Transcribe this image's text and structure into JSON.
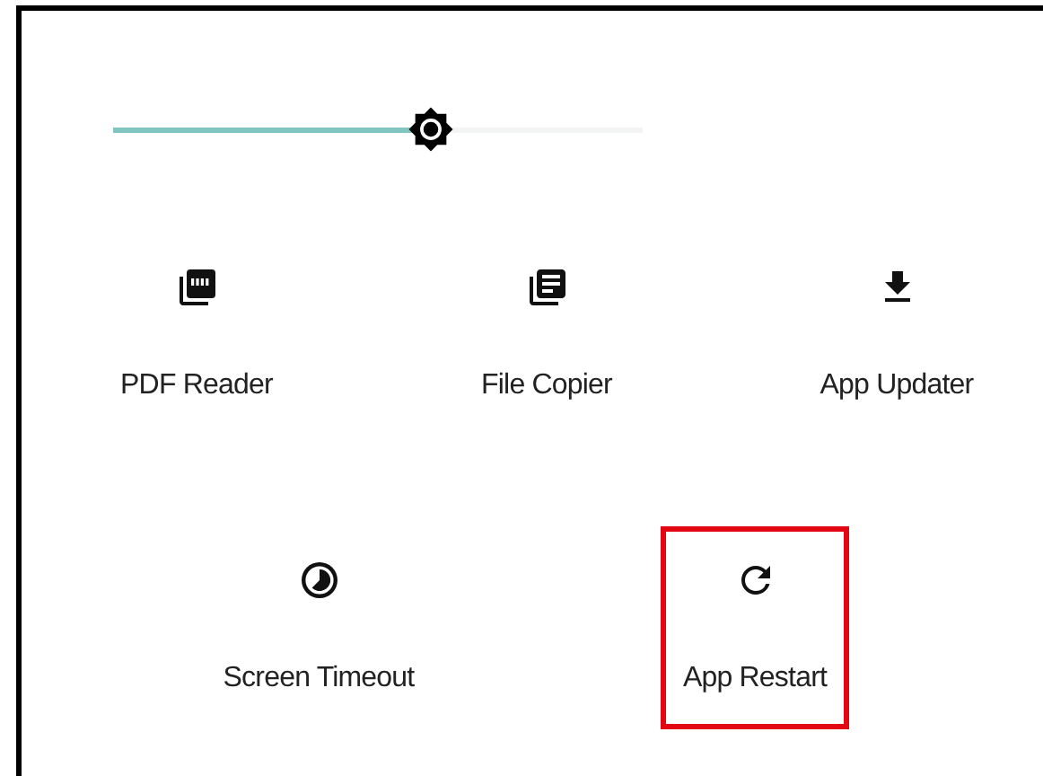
{
  "brightness": {
    "level": 0.6
  },
  "rows": [
    [
      {
        "label": "PDF Reader",
        "highlighted": false
      },
      {
        "label": "File Copier",
        "highlighted": false
      },
      {
        "label": "App Updater",
        "highlighted": false
      }
    ],
    [
      {
        "label": "Screen Timeout",
        "highlighted": false
      },
      {
        "label": "App Restart",
        "highlighted": true
      }
    ]
  ]
}
